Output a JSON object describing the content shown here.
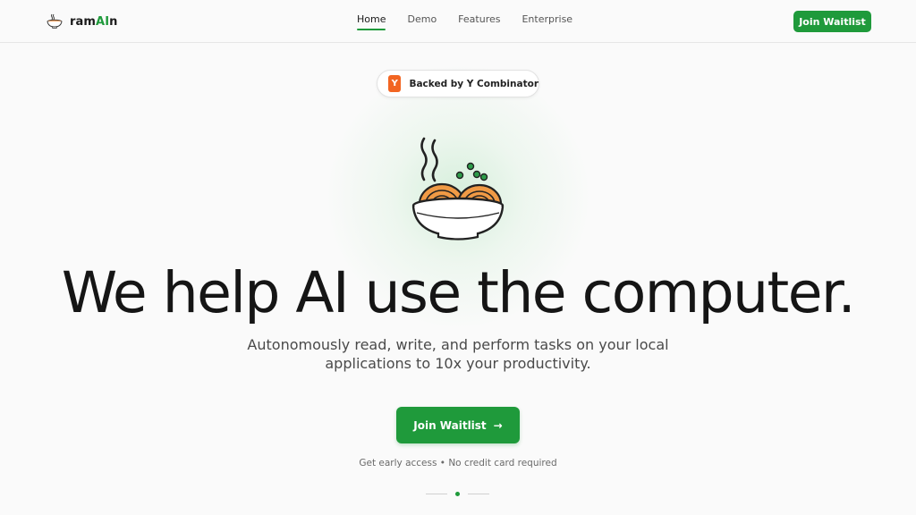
{
  "brand": {
    "name_prefix": "ram",
    "name_highlight": "AI",
    "name_suffix": "n",
    "logo_icon": "ramen-bowl-icon",
    "accent_color": "#1f9a3b"
  },
  "nav": {
    "items": [
      {
        "label": "Home",
        "active": true
      },
      {
        "label": "Demo",
        "active": false
      },
      {
        "label": "Features",
        "active": false
      },
      {
        "label": "Enterprise",
        "active": false
      }
    ],
    "cta_label": "Join Waitlist"
  },
  "badge": {
    "logo_letter": "Y",
    "logo_color": "#f26522",
    "text": "Backed by Y Combinator"
  },
  "hero": {
    "illustration": "ramen-bowl-icon",
    "title": "We help AI use the computer.",
    "subtitle_line1": "Autonomously read, write, and perform tasks on your local",
    "subtitle_line2": "applications to 10x your productivity.",
    "cta_label": "Join Waitlist",
    "cta_icon": "arrow-right-icon",
    "note": "Get early access • No credit card required"
  },
  "scroll_indicator": {
    "active_index": 0
  }
}
